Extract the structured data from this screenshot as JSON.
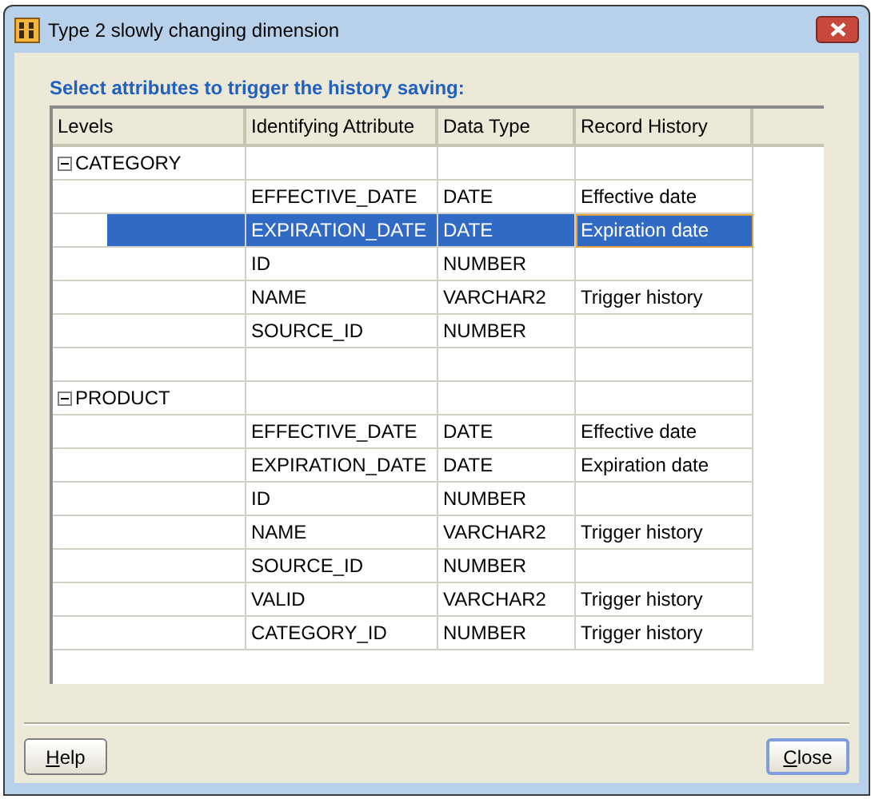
{
  "window": {
    "title": "Type 2 slowly changing dimension"
  },
  "instruction": "Select attributes to trigger the history saving:",
  "table": {
    "columns": [
      "Levels",
      "Identifying Attribute",
      "Data Type",
      "Record History"
    ],
    "rows": [
      {
        "kind": "group",
        "level": "CATEGORY",
        "expanded": true
      },
      {
        "kind": "attribute",
        "attribute": "EFFECTIVE_DATE",
        "data_type": "DATE",
        "record_history": "Effective date",
        "selected": false,
        "focused": false
      },
      {
        "kind": "attribute",
        "attribute": "EXPIRATION_DATE",
        "data_type": "DATE",
        "record_history": "Expiration date",
        "selected": true,
        "focused": true
      },
      {
        "kind": "attribute",
        "attribute": "ID",
        "data_type": "NUMBER",
        "selected": false,
        "focused": false
      },
      {
        "kind": "attribute",
        "attribute": "NAME",
        "data_type": "VARCHAR2",
        "record_history": "Trigger history",
        "selected": false,
        "focused": false
      },
      {
        "kind": "attribute",
        "attribute": "SOURCE_ID",
        "data_type": "NUMBER",
        "selected": false,
        "focused": false
      },
      {
        "kind": "blank"
      },
      {
        "kind": "group",
        "level": "PRODUCT",
        "expanded": true
      },
      {
        "kind": "attribute",
        "attribute": "EFFECTIVE_DATE",
        "data_type": "DATE",
        "record_history": "Effective date",
        "selected": false,
        "focused": false
      },
      {
        "kind": "attribute",
        "attribute": "EXPIRATION_DATE",
        "data_type": "DATE",
        "record_history": "Expiration date",
        "selected": false,
        "focused": false
      },
      {
        "kind": "attribute",
        "attribute": "ID",
        "data_type": "NUMBER",
        "selected": false,
        "focused": false
      },
      {
        "kind": "attribute",
        "attribute": "NAME",
        "data_type": "VARCHAR2",
        "record_history": "Trigger history",
        "selected": false,
        "focused": false
      },
      {
        "kind": "attribute",
        "attribute": "SOURCE_ID",
        "data_type": "NUMBER",
        "selected": false,
        "focused": false
      },
      {
        "kind": "attribute",
        "attribute": "VALID",
        "data_type": "VARCHAR2",
        "record_history": "Trigger history",
        "selected": false,
        "focused": false
      },
      {
        "kind": "attribute",
        "attribute": "CATEGORY_ID",
        "data_type": "NUMBER",
        "record_history": "Trigger history",
        "selected": false,
        "focused": false
      }
    ]
  },
  "buttons": [
    {
      "label": "Help",
      "default": false
    },
    {
      "label": "Close",
      "default": true
    }
  ]
}
